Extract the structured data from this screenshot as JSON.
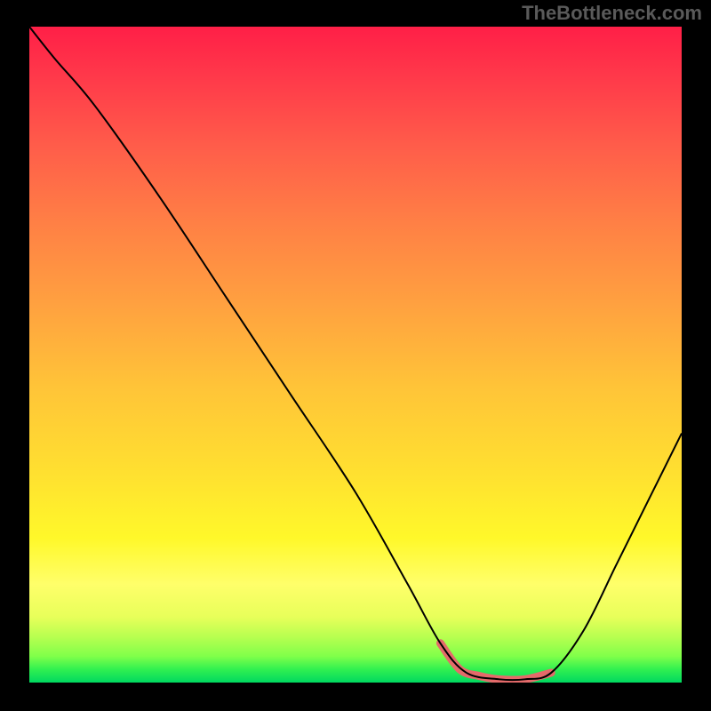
{
  "watermark": "TheBottleneck.com",
  "gradient": {
    "top": "#ff1f47",
    "middle": "#ffe030",
    "bottom": "#00d860"
  },
  "chart_data": {
    "type": "line",
    "title": "",
    "xlabel": "",
    "ylabel": "",
    "xlim": [
      0,
      100
    ],
    "ylim": [
      0,
      100
    ],
    "grid": false,
    "series": [
      {
        "name": "curve",
        "color": "#000000",
        "stroke_width": 2,
        "x": [
          0,
          4,
          10,
          20,
          30,
          40,
          50,
          58,
          63,
          67,
          72,
          76,
          80,
          85,
          90,
          95,
          100
        ],
        "y": [
          100,
          95,
          88,
          74,
          59,
          44,
          29,
          15,
          6,
          1.5,
          0.5,
          0.5,
          1.5,
          8,
          18,
          28,
          38
        ]
      },
      {
        "name": "highlight",
        "color": "#e46a6a",
        "stroke_width": 9,
        "linecap": "round",
        "x": [
          63,
          66,
          69,
          72,
          76,
          80
        ],
        "y": [
          6,
          2,
          1,
          0.5,
          0.5,
          1.5
        ]
      }
    ]
  }
}
